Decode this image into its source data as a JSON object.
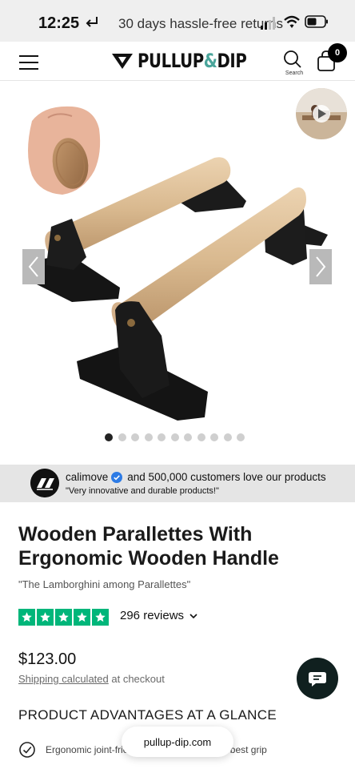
{
  "status_bar": {
    "time": "12:25",
    "notice": "30 days hassle-free returns",
    "icons": [
      "return-arrow-icon",
      "signal-icon",
      "wifi-icon",
      "battery-icon"
    ]
  },
  "header": {
    "brand_left": "PULLUP",
    "brand_amp": "&",
    "brand_right": "DIP",
    "search_label": "Search",
    "cart_count": "0",
    "brand_accent_color": "#4aa59b"
  },
  "gallery": {
    "slide_count": 11,
    "active_slide": 1
  },
  "banner": {
    "name": "calimove",
    "message": "and 500,000 customers love our products",
    "quote": "\"Very innovative and durable products!\""
  },
  "product": {
    "title": "Wooden Parallettes With Ergonomic Wooden Handle",
    "subtitle": "\"The Lamborghini among Parallettes\"",
    "rating_stars": 5,
    "reviews": "296 reviews",
    "price": "$123.00",
    "shipping_link": "Shipping calculated",
    "shipping_rest": " at checkout",
    "star_color": "#00b67a"
  },
  "advantages": {
    "heading": "PRODUCT ADVANTAGES AT A GLANCE",
    "first_item": "Ergonomic joint-friendly wooden handle for best grip"
  },
  "browser": {
    "url": "pullup-dip.com"
  }
}
